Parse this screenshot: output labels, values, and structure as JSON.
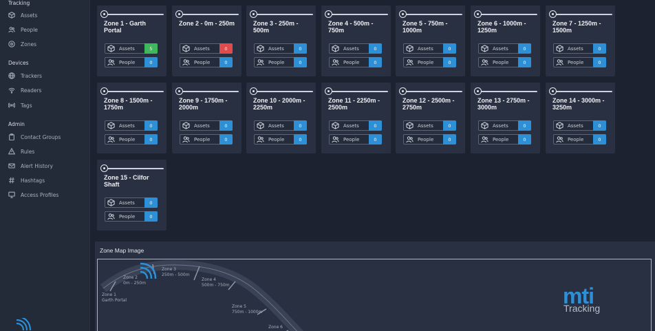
{
  "sidebar": {
    "sections": [
      {
        "title": "Tracking",
        "items": [
          {
            "label": "Assets",
            "icon": "cube-icon"
          },
          {
            "label": "People",
            "icon": "people-icon"
          },
          {
            "label": "Zones",
            "icon": "target-icon"
          }
        ]
      },
      {
        "title": "Devices",
        "items": [
          {
            "label": "Trackers",
            "icon": "globe-icon"
          },
          {
            "label": "Readers",
            "icon": "wifi-icon"
          },
          {
            "label": "Tags",
            "icon": "broadcast-icon"
          }
        ]
      },
      {
        "title": "Admin",
        "items": [
          {
            "label": "Contact Groups",
            "icon": "clipboard-icon"
          },
          {
            "label": "Rules",
            "icon": "warning-icon"
          },
          {
            "label": "Alert History",
            "icon": "mail-icon"
          },
          {
            "label": "Hashtags",
            "icon": "hash-icon"
          },
          {
            "label": "Access Profiles",
            "icon": "monitor-icon"
          }
        ]
      }
    ]
  },
  "stat_labels": {
    "assets": "Assets",
    "people": "People"
  },
  "status_colors": {
    "blue": "#2d8fd6",
    "green": "#3db85a",
    "red": "#e24b4b"
  },
  "zones": [
    {
      "title": "Zone 1 - Garth Portal",
      "assets": "5",
      "assets_status": "green",
      "people": "0"
    },
    {
      "title": "Zone 2 - 0m - 250m",
      "assets": "0",
      "assets_status": "red",
      "people": "0"
    },
    {
      "title": "Zone 3 - 250m - 500m",
      "assets": "0",
      "assets_status": "blue",
      "people": "0"
    },
    {
      "title": "Zone 4 - 500m - 750m",
      "assets": "0",
      "assets_status": "blue",
      "people": "0"
    },
    {
      "title": "Zone 5 - 750m - 1000m",
      "assets": "0",
      "assets_status": "blue",
      "people": "0"
    },
    {
      "title": "Zone 6 - 1000m - 1250m",
      "assets": "0",
      "assets_status": "blue",
      "people": "0"
    },
    {
      "title": "Zone 7 - 1250m - 1500m",
      "assets": "0",
      "assets_status": "blue",
      "people": "0"
    },
    {
      "title": "Zone 8 - 1500m - 1750m",
      "assets": "0",
      "assets_status": "blue",
      "people": "0"
    },
    {
      "title": "Zone 9 - 1750m - 2000m",
      "assets": "0",
      "assets_status": "blue",
      "people": "0"
    },
    {
      "title": "Zone 10 - 2000m - 2250m",
      "assets": "0",
      "assets_status": "blue",
      "people": "0"
    },
    {
      "title": "Zone 11 - 2250m - 2500m",
      "assets": "0",
      "assets_status": "blue",
      "people": "0"
    },
    {
      "title": "Zone 12 - 2500m - 2750m",
      "assets": "0",
      "assets_status": "blue",
      "people": "0"
    },
    {
      "title": "Zone 13 - 2750m - 3000m",
      "assets": "0",
      "assets_status": "blue",
      "people": "0"
    },
    {
      "title": "Zone 14 - 3000m - 3250m",
      "assets": "0",
      "assets_status": "blue",
      "people": "0"
    },
    {
      "title": "Zone 15 - Cilfor Shaft",
      "assets": "0",
      "assets_status": "blue",
      "people": "0"
    }
  ],
  "zone_map": {
    "title": "Zone Map Image",
    "labels": [
      {
        "name": "Zone 1",
        "range": "Garth Portal"
      },
      {
        "name": "Zone 2",
        "range": "0m - 250m"
      },
      {
        "name": "Zone 3",
        "range": "250m - 500m"
      },
      {
        "name": "Zone 4",
        "range": "500m - 750m"
      },
      {
        "name": "Zone 5",
        "range": "750m - 1000m"
      },
      {
        "name": "Zone 6",
        "range": ""
      }
    ],
    "logo_text": "mti",
    "logo_subtext": "Tracking"
  }
}
